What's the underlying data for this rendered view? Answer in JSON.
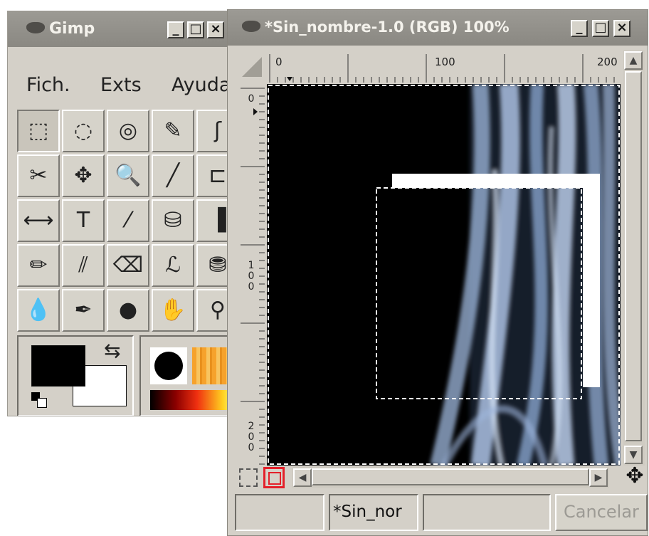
{
  "toolbox": {
    "title": "Gimp",
    "menus": [
      {
        "label": "Fich."
      },
      {
        "label": "Exts"
      },
      {
        "label": "Ayuda"
      }
    ],
    "tools": [
      {
        "name": "rect-select-tool",
        "glyph": "⬚"
      },
      {
        "name": "ellipse-select-tool",
        "glyph": "◌"
      },
      {
        "name": "free-select-tool",
        "glyph": "◎"
      },
      {
        "name": "fuzzy-select-tool",
        "glyph": "✎"
      },
      {
        "name": "bezier-select-tool",
        "glyph": "ʃ"
      },
      {
        "name": "scissors-tool",
        "glyph": "✂"
      },
      {
        "name": "move-tool",
        "glyph": "✥"
      },
      {
        "name": "zoom-tool",
        "glyph": "🔍"
      },
      {
        "name": "measure-tool",
        "glyph": "╱"
      },
      {
        "name": "crop-tool",
        "glyph": "⊏"
      },
      {
        "name": "flip-tool",
        "glyph": "⟷"
      },
      {
        "name": "text-tool",
        "glyph": "T"
      },
      {
        "name": "color-picker-tool",
        "glyph": "⁄"
      },
      {
        "name": "bucket-fill-tool",
        "glyph": "⛁"
      },
      {
        "name": "blend-tool",
        "glyph": "▐"
      },
      {
        "name": "pencil-tool",
        "glyph": "✏"
      },
      {
        "name": "paintbrush-tool",
        "glyph": "⫽"
      },
      {
        "name": "eraser-tool",
        "glyph": "⌫"
      },
      {
        "name": "airbrush-tool",
        "glyph": "ℒ"
      },
      {
        "name": "clone-tool",
        "glyph": "⛃"
      },
      {
        "name": "blur-tool",
        "glyph": "💧"
      },
      {
        "name": "ink-tool",
        "glyph": "✒"
      },
      {
        "name": "dodge-burn-tool",
        "glyph": "●"
      },
      {
        "name": "smudge-tool",
        "glyph": "✋"
      },
      {
        "name": "measure-compass-tool",
        "glyph": "⚲"
      }
    ],
    "foreground_color": "#000000",
    "background_color": "#ffffff"
  },
  "image_window": {
    "title": "*Sin_nombre-1.0 (RGB) 100%",
    "rulers": {
      "h_labels": [
        "0",
        "100",
        "200"
      ],
      "v_labels": [
        "0",
        "100",
        "200"
      ]
    },
    "status": {
      "field1": "",
      "field2": "*Sin_nor",
      "field3": "",
      "cancel_label": "Cancelar"
    }
  }
}
